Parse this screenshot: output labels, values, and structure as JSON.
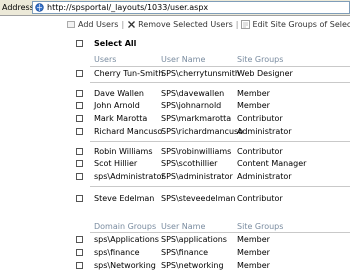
{
  "address": {
    "label": "Address",
    "url": "http://spsportal/_layouts/1033/user.aspx"
  },
  "toolbar": {
    "add_users": "Add Users",
    "remove_selected": "Remove Selected Users",
    "edit_site_groups": "Edit Site Groups of Selected"
  },
  "select_all": "Select All",
  "users_table": {
    "headers": [
      "Users",
      "User Name",
      "Site Groups"
    ],
    "rows": [
      {
        "user": "Cherry Tun-Smith",
        "username": "SPS\\cherrytunsmith",
        "group": "Web Designer"
      },
      {
        "user": "Dave Wallen",
        "username": "SPS\\davewallen",
        "group": "Member"
      },
      {
        "user": "John Arnold",
        "username": "SPS\\johnarnold",
        "group": "Member"
      },
      {
        "user": "Mark Marotta",
        "username": "SPS\\markmarotta",
        "group": "Contributor"
      },
      {
        "user": "Richard Mancuso",
        "username": "SPS\\richardmancuso",
        "group": "Administrator"
      },
      {
        "user": "Robin Williams",
        "username": "SPS\\robinwilliams",
        "group": "Contributor"
      },
      {
        "user": "Scot Hillier",
        "username": "SPS\\scothillier",
        "group": "Content Manager"
      },
      {
        "user": "sps\\Administrator",
        "username": "SPS\\administrator",
        "group": "Administrator"
      },
      {
        "user": "Steve Edelman",
        "username": "SPS\\steveedelman",
        "group": "Contributor"
      }
    ]
  },
  "domain_table": {
    "headers": [
      "Domain Groups",
      "User Name",
      "Site Groups"
    ],
    "rows": [
      {
        "user": "sps\\Applications",
        "username": "SPS\\applications",
        "group": "Member"
      },
      {
        "user": "sps\\finance",
        "username": "SPS\\finance",
        "group": "Member"
      },
      {
        "user": "sps\\Networking",
        "username": "SPS\\networking",
        "group": "Member"
      }
    ]
  }
}
